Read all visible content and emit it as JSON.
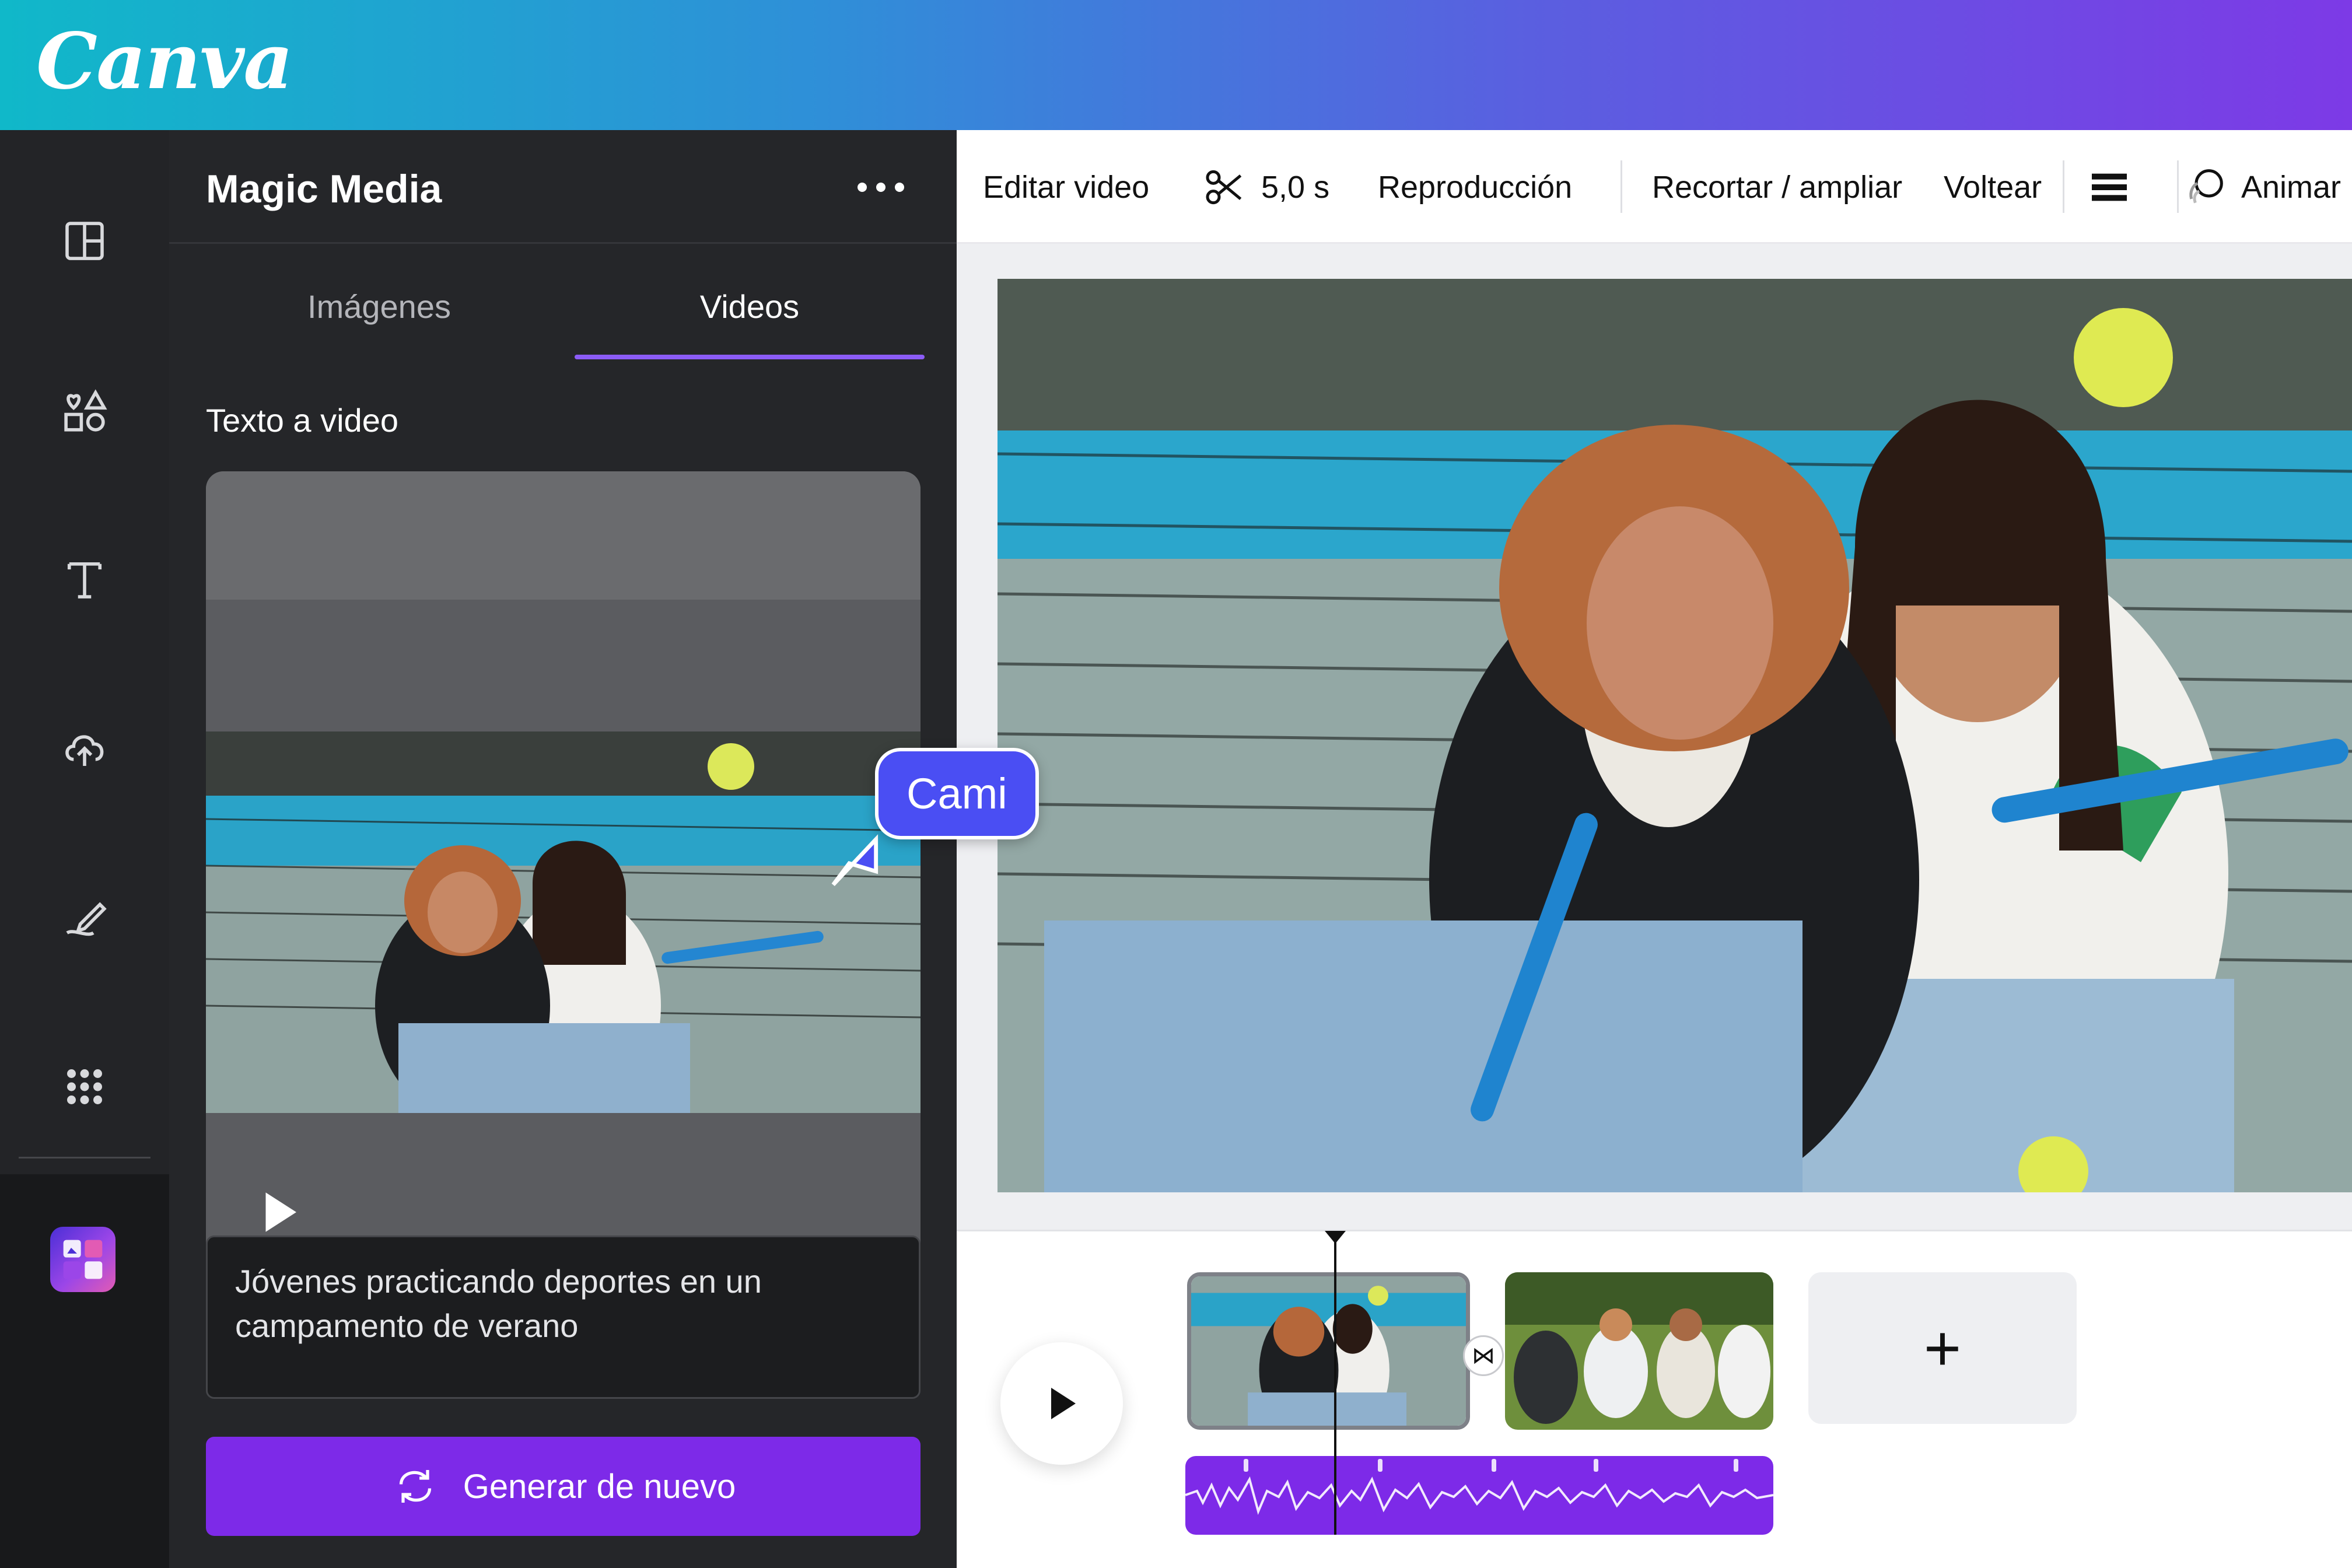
{
  "brand": {
    "logo": "Canva"
  },
  "rail": {
    "items": [
      {
        "name": "layout-icon"
      },
      {
        "name": "elements-icon"
      },
      {
        "name": "text-icon"
      },
      {
        "name": "upload-icon"
      },
      {
        "name": "draw-icon"
      },
      {
        "name": "apps-icon"
      }
    ],
    "active_app": "magic-media-icon"
  },
  "panel": {
    "title": "Magic Media",
    "more_label": "•••",
    "tabs": [
      {
        "label": "Imágenes",
        "active": false
      },
      {
        "label": "Videos",
        "active": true
      }
    ],
    "section_title": "Texto a video",
    "prompt_text": "Jóvenes practicando deportes en un campamento de verano",
    "generate_label": "Generar de nuevo"
  },
  "toolbar": {
    "edit_video": "Editar video",
    "duration": "5,0 s",
    "playback": "Reproducción",
    "crop": "Recortar / ampliar",
    "flip": "Voltear",
    "animate": "Animar"
  },
  "timeline": {
    "add_label": "+",
    "transition_symbol": "⋈"
  },
  "collaborator": {
    "name": "Cami"
  },
  "colors": {
    "accent": "#7d2ae8",
    "cursor": "#4a4ef3",
    "panel_bg": "#252629"
  }
}
